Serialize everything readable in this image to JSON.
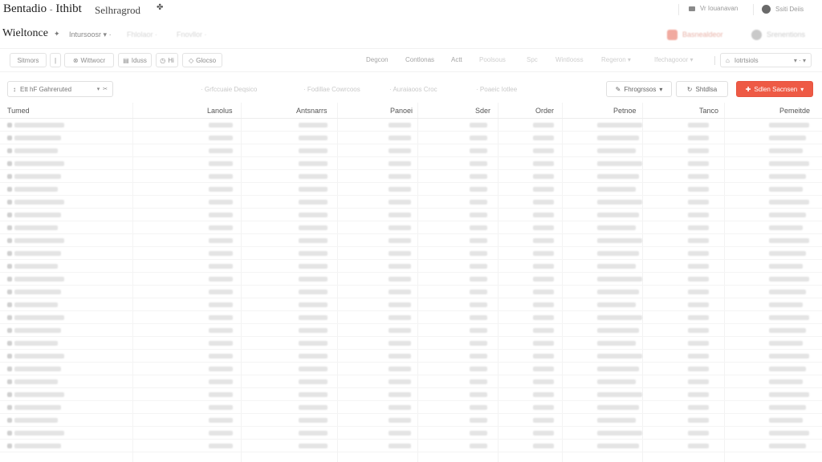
{
  "app": {
    "title": "Bentadio",
    "divider": "-",
    "subtitle": "Ithibt",
    "section": "Selhragrod",
    "section_icon": "sparkle-icon"
  },
  "top_right": {
    "item1_label": "Vr Iouanavan",
    "item2_label": "Ssiti Deiis"
  },
  "header": {
    "page_title": "Wieltonce",
    "title_icon": "pin-icon",
    "breadcrumb1": "Intursoosr",
    "breadcrumb2": "Fhlolaor",
    "breadcrumb3": "Fnovllor",
    "action_red": "Basnealdeor",
    "action_gray": "Srenentions",
    "accent_color": "#ee5a45"
  },
  "toolbar": {
    "chips": [
      "Sitmors",
      "|",
      "Wittwocr",
      "Iduss",
      "Hi",
      "Glocso"
    ],
    "tabs": [
      "Degcon",
      "Contlonas",
      "Actt",
      "Poolsous",
      "Spc",
      "Wintlooss",
      "Regeron",
      "Ifechagooor"
    ],
    "right_select": "Iotrtsiols"
  },
  "filters": {
    "select_label": "Ett hF Gahreruted",
    "ghost": [
      "Grfccuaie Deqsico",
      "Fodillae Cowrcoos",
      "Auraiaoos Croc",
      "Poaeic Iotlee"
    ],
    "btn_outline1": "Fhrogrssos",
    "btn_outline2": "Shtdlsa",
    "btn_primary": "Sdlen Sacnsen"
  },
  "table": {
    "headers": [
      "Tumed",
      "Lanolus",
      "Antsnarrs",
      "Panoei",
      "Sder",
      "Order",
      "Petnoe",
      "Tanco",
      "Pemeitde"
    ]
  }
}
